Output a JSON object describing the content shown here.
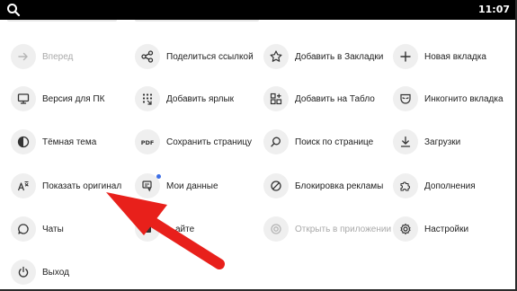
{
  "statusbar": {
    "time": "11:07"
  },
  "menu": [
    {
      "label": "Вперед",
      "icon": "arrow-right-icon",
      "disabled": true
    },
    {
      "label": "Поделиться ссылкой",
      "icon": "share-icon"
    },
    {
      "label": "Добавить в Закладки",
      "icon": "star-icon"
    },
    {
      "label": "Новая вкладка",
      "icon": "plus-icon"
    },
    {
      "label": "Версия для ПК",
      "icon": "desktop-icon"
    },
    {
      "label": "Добавить ярлык",
      "icon": "shortcut-grid-icon"
    },
    {
      "label": "Добавить на Табло",
      "icon": "dashboard-icon"
    },
    {
      "label": "Инкогнито вкладка",
      "icon": "incognito-mask-icon"
    },
    {
      "label": "Тёмная тема",
      "icon": "half-circle-icon"
    },
    {
      "label": "Сохранить страницу",
      "icon": "pdf-icon"
    },
    {
      "label": "Поиск по странице",
      "icon": "find-icon"
    },
    {
      "label": "Загрузки",
      "icon": "download-icon"
    },
    {
      "label": "Показать оригинал",
      "icon": "translate-icon"
    },
    {
      "label": "Мои данные",
      "icon": "my-data-icon",
      "badge": true
    },
    {
      "label": "Блокировка рекламы",
      "icon": "block-icon"
    },
    {
      "label": "Дополнения",
      "icon": "puzzle-icon"
    },
    {
      "label": "Чаты",
      "icon": "chat-bubble-icon"
    },
    {
      "label": "…айте",
      "icon": "unknown-icon"
    },
    {
      "label": "Открыть в приложении",
      "icon": "open-in-app-icon",
      "disabled": true
    },
    {
      "label": "Настройки",
      "icon": "gear-icon"
    },
    {
      "label": "Выход",
      "icon": "power-icon"
    }
  ],
  "colors": {
    "annotation_arrow": "#e8201b",
    "badge": "#3d6ee5"
  }
}
